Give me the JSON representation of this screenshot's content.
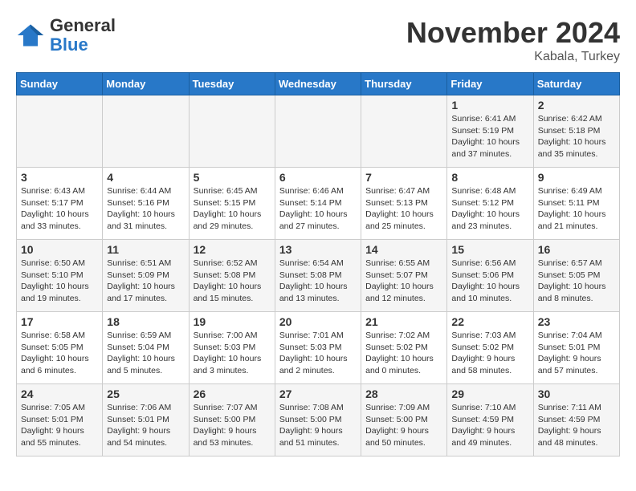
{
  "header": {
    "logo_general": "General",
    "logo_blue": "Blue",
    "month": "November 2024",
    "location": "Kabala, Turkey"
  },
  "weekdays": [
    "Sunday",
    "Monday",
    "Tuesday",
    "Wednesday",
    "Thursday",
    "Friday",
    "Saturday"
  ],
  "weeks": [
    [
      {
        "day": "",
        "info": ""
      },
      {
        "day": "",
        "info": ""
      },
      {
        "day": "",
        "info": ""
      },
      {
        "day": "",
        "info": ""
      },
      {
        "day": "",
        "info": ""
      },
      {
        "day": "1",
        "info": "Sunrise: 6:41 AM\nSunset: 5:19 PM\nDaylight: 10 hours\nand 37 minutes."
      },
      {
        "day": "2",
        "info": "Sunrise: 6:42 AM\nSunset: 5:18 PM\nDaylight: 10 hours\nand 35 minutes."
      }
    ],
    [
      {
        "day": "3",
        "info": "Sunrise: 6:43 AM\nSunset: 5:17 PM\nDaylight: 10 hours\nand 33 minutes."
      },
      {
        "day": "4",
        "info": "Sunrise: 6:44 AM\nSunset: 5:16 PM\nDaylight: 10 hours\nand 31 minutes."
      },
      {
        "day": "5",
        "info": "Sunrise: 6:45 AM\nSunset: 5:15 PM\nDaylight: 10 hours\nand 29 minutes."
      },
      {
        "day": "6",
        "info": "Sunrise: 6:46 AM\nSunset: 5:14 PM\nDaylight: 10 hours\nand 27 minutes."
      },
      {
        "day": "7",
        "info": "Sunrise: 6:47 AM\nSunset: 5:13 PM\nDaylight: 10 hours\nand 25 minutes."
      },
      {
        "day": "8",
        "info": "Sunrise: 6:48 AM\nSunset: 5:12 PM\nDaylight: 10 hours\nand 23 minutes."
      },
      {
        "day": "9",
        "info": "Sunrise: 6:49 AM\nSunset: 5:11 PM\nDaylight: 10 hours\nand 21 minutes."
      }
    ],
    [
      {
        "day": "10",
        "info": "Sunrise: 6:50 AM\nSunset: 5:10 PM\nDaylight: 10 hours\nand 19 minutes."
      },
      {
        "day": "11",
        "info": "Sunrise: 6:51 AM\nSunset: 5:09 PM\nDaylight: 10 hours\nand 17 minutes."
      },
      {
        "day": "12",
        "info": "Sunrise: 6:52 AM\nSunset: 5:08 PM\nDaylight: 10 hours\nand 15 minutes."
      },
      {
        "day": "13",
        "info": "Sunrise: 6:54 AM\nSunset: 5:08 PM\nDaylight: 10 hours\nand 13 minutes."
      },
      {
        "day": "14",
        "info": "Sunrise: 6:55 AM\nSunset: 5:07 PM\nDaylight: 10 hours\nand 12 minutes."
      },
      {
        "day": "15",
        "info": "Sunrise: 6:56 AM\nSunset: 5:06 PM\nDaylight: 10 hours\nand 10 minutes."
      },
      {
        "day": "16",
        "info": "Sunrise: 6:57 AM\nSunset: 5:05 PM\nDaylight: 10 hours\nand 8 minutes."
      }
    ],
    [
      {
        "day": "17",
        "info": "Sunrise: 6:58 AM\nSunset: 5:05 PM\nDaylight: 10 hours\nand 6 minutes."
      },
      {
        "day": "18",
        "info": "Sunrise: 6:59 AM\nSunset: 5:04 PM\nDaylight: 10 hours\nand 5 minutes."
      },
      {
        "day": "19",
        "info": "Sunrise: 7:00 AM\nSunset: 5:03 PM\nDaylight: 10 hours\nand 3 minutes."
      },
      {
        "day": "20",
        "info": "Sunrise: 7:01 AM\nSunset: 5:03 PM\nDaylight: 10 hours\nand 2 minutes."
      },
      {
        "day": "21",
        "info": "Sunrise: 7:02 AM\nSunset: 5:02 PM\nDaylight: 10 hours\nand 0 minutes."
      },
      {
        "day": "22",
        "info": "Sunrise: 7:03 AM\nSunset: 5:02 PM\nDaylight: 9 hours\nand 58 minutes."
      },
      {
        "day": "23",
        "info": "Sunrise: 7:04 AM\nSunset: 5:01 PM\nDaylight: 9 hours\nand 57 minutes."
      }
    ],
    [
      {
        "day": "24",
        "info": "Sunrise: 7:05 AM\nSunset: 5:01 PM\nDaylight: 9 hours\nand 55 minutes."
      },
      {
        "day": "25",
        "info": "Sunrise: 7:06 AM\nSunset: 5:01 PM\nDaylight: 9 hours\nand 54 minutes."
      },
      {
        "day": "26",
        "info": "Sunrise: 7:07 AM\nSunset: 5:00 PM\nDaylight: 9 hours\nand 53 minutes."
      },
      {
        "day": "27",
        "info": "Sunrise: 7:08 AM\nSunset: 5:00 PM\nDaylight: 9 hours\nand 51 minutes."
      },
      {
        "day": "28",
        "info": "Sunrise: 7:09 AM\nSunset: 5:00 PM\nDaylight: 9 hours\nand 50 minutes."
      },
      {
        "day": "29",
        "info": "Sunrise: 7:10 AM\nSunset: 4:59 PM\nDaylight: 9 hours\nand 49 minutes."
      },
      {
        "day": "30",
        "info": "Sunrise: 7:11 AM\nSunset: 4:59 PM\nDaylight: 9 hours\nand 48 minutes."
      }
    ]
  ]
}
